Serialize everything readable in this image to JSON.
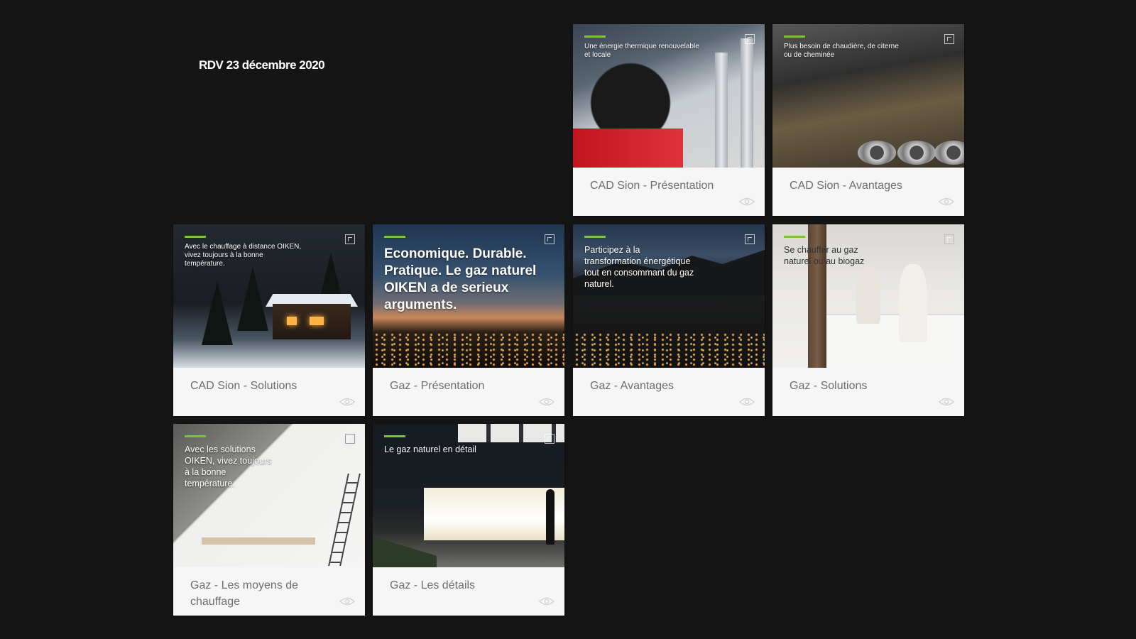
{
  "page": {
    "title": "RDV 23 décembre 2020"
  },
  "cards": [
    {
      "label": "CAD Sion - Présentation",
      "overlay": "Une énergie thermique renouvelable et locale",
      "image": "boiler-room-photo"
    },
    {
      "label": "CAD Sion - Avantages",
      "overlay": "Plus besoin de chaudière, de citerne ou de cheminée",
      "image": "pipes-photo"
    },
    {
      "label": "CAD Sion - Solutions",
      "overlay": "Avec le chauffage à distance OIKEN, vivez toujours à la bonne température.",
      "image": "snowy-chalet-photo"
    },
    {
      "label": "Gaz - Présentation",
      "overlay": "Economique. Durable. Pratique. Le gaz naturel OIKEN a de serieux arguments.",
      "image": "valley-dusk-photo"
    },
    {
      "label": "Gaz - Avantages",
      "overlay": "Participez à la transformation énergétique tout en consommant du gaz naturel.",
      "image": "mountain-night-photo"
    },
    {
      "label": "Gaz - Solutions",
      "overlay": "Se chauffer au gaz naturel ou au biogaz",
      "image": "kitchen-family-photo"
    },
    {
      "label": "Gaz - Les moyens de chauffage",
      "overlay": "Avec les solutions OIKEN, vivez toujours à la bonne température.",
      "image": "attic-family-photo"
    },
    {
      "label": "Gaz - Les détails",
      "overlay": "Le gaz naturel en détail",
      "image": "modern-house-photo"
    }
  ],
  "icons": {
    "expand": "expand-icon",
    "view": "eye-icon"
  },
  "colors": {
    "background": "#151515",
    "card": "#f6f6f6",
    "label": "#6e6e6e",
    "accent": "#7cc242"
  }
}
